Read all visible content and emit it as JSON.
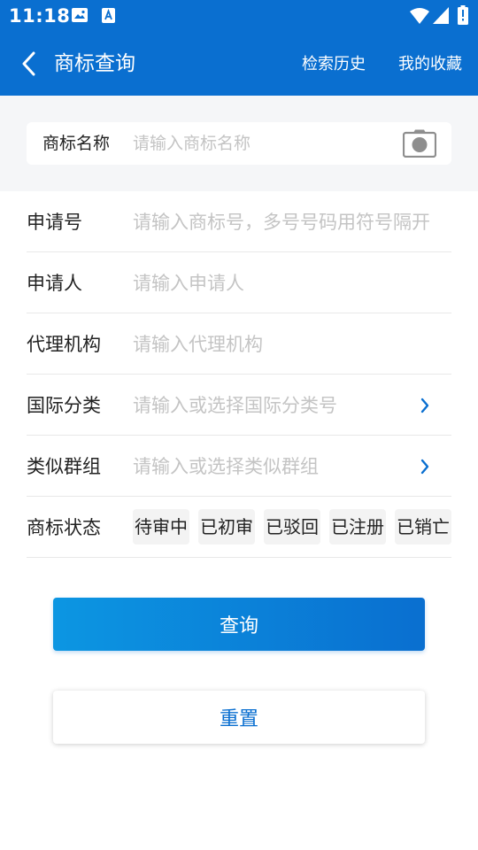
{
  "status_bar": {
    "time": "11:18",
    "icons": [
      "image-icon",
      "a-icon",
      "wifi-icon",
      "signal-icon",
      "battery-icon"
    ]
  },
  "header": {
    "back_icon": "chevron-left-icon",
    "title": "商标查询",
    "history_label": "检索历史",
    "favorites_label": "我的收藏"
  },
  "search": {
    "label": "商标名称",
    "placeholder": "请输入商标名称",
    "camera_icon": "camera-icon"
  },
  "form": {
    "application_number": {
      "label": "申请号",
      "placeholder": "请输入商标号，多号号码用符号隔开"
    },
    "applicant": {
      "label": "申请人",
      "placeholder": "请输入申请人"
    },
    "agency": {
      "label": "代理机构",
      "placeholder": "请输入代理机构"
    },
    "international_class": {
      "label": "国际分类",
      "placeholder": "请输入或选择国际分类号",
      "arrow_icon": "chevron-right-icon"
    },
    "similar_group": {
      "label": "类似群组",
      "placeholder": "请输入或选择类似群组",
      "arrow_icon": "chevron-right-icon"
    },
    "status": {
      "label": "商标状态",
      "options": [
        "待审中",
        "已初审",
        "已驳回",
        "已注册",
        "已销亡"
      ]
    }
  },
  "buttons": {
    "query_label": "查询",
    "reset_label": "重置"
  },
  "colors": {
    "primary": "#0a6fd0",
    "gradient_start": "#0c96e2",
    "section_background": "#f5f6f8",
    "placeholder": "#c4c4c4",
    "divider": "#e8e8e8",
    "chip_background": "#f3f3f3"
  }
}
